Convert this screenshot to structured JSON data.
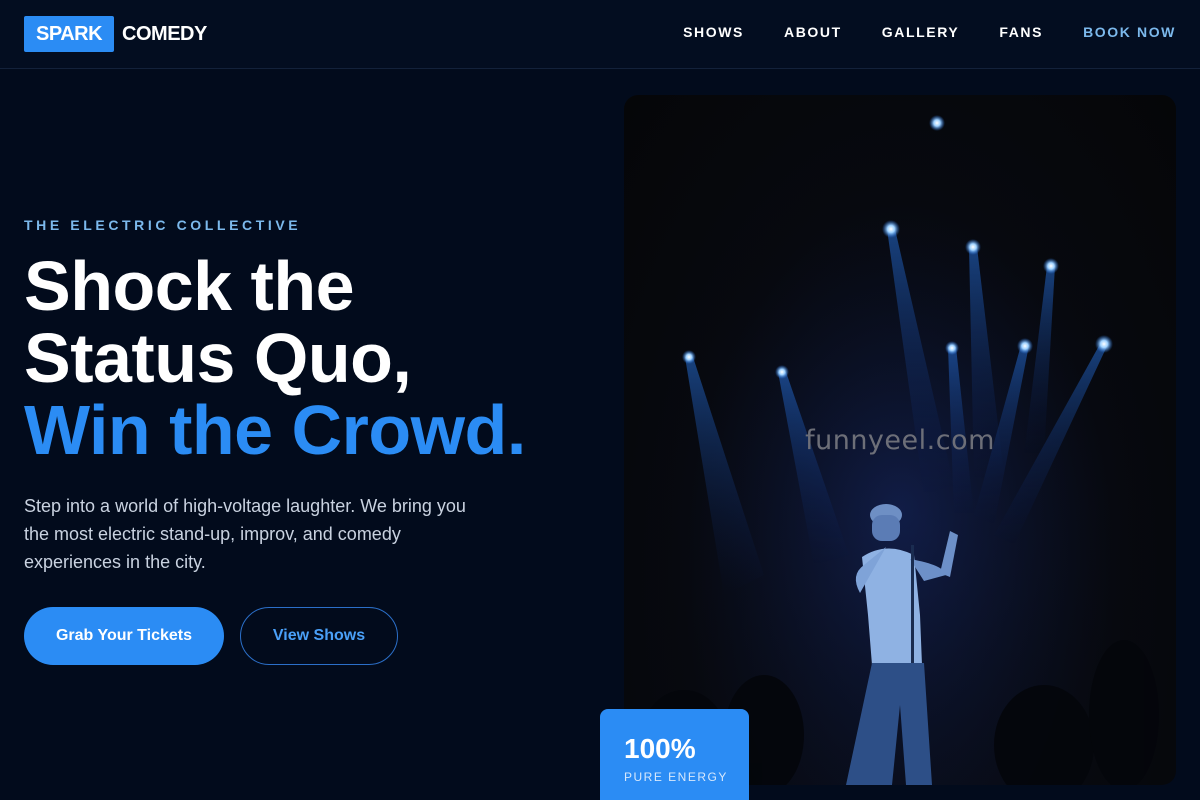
{
  "brand": {
    "badge": "SPARK",
    "name": "COMEDY"
  },
  "nav": {
    "items": [
      "SHOWS",
      "ABOUT",
      "GALLERY",
      "FANS"
    ],
    "cta": "BOOK NOW"
  },
  "hero": {
    "eyebrow": "THE ELECTRIC COLLECTIVE",
    "headline_line1": "Shock the",
    "headline_line2": "Status Quo,",
    "headline_accent": "Win the Crowd.",
    "description": "Step into a world of high-voltage laughter. We bring you the most electric stand-up, improv, and comedy experiences in the city.",
    "primary_button": "Grab Your Tickets",
    "secondary_button": "View Shows",
    "image_watermark": "funnyeel.com"
  },
  "stat": {
    "value": "100%",
    "label": "PURE ENERGY"
  },
  "colors": {
    "accent": "#2b8cf4",
    "background": "#020b1c",
    "eyebrow": "#7cb9ec"
  }
}
